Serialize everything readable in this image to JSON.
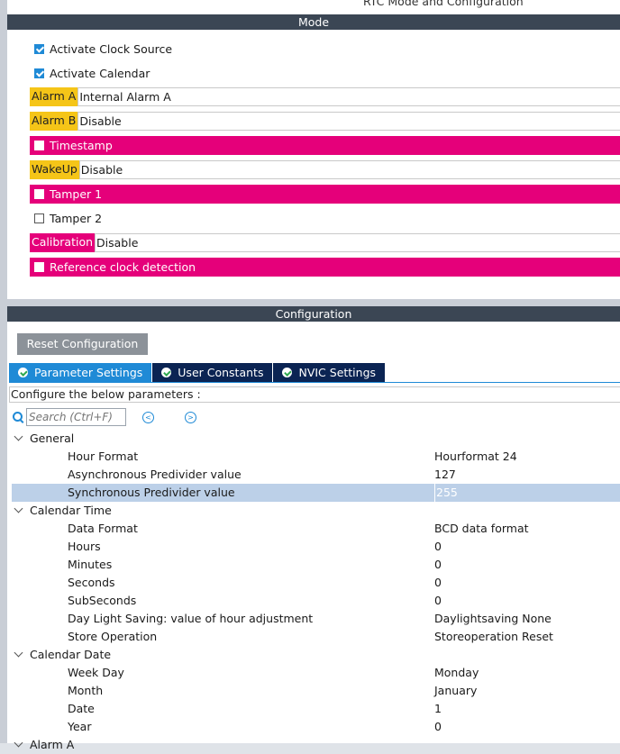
{
  "window": {
    "title": "RTC Mode and Configuration"
  },
  "mode": {
    "header": "Mode",
    "activate_clock_source": {
      "label": "Activate Clock Source",
      "checked": true
    },
    "activate_calendar": {
      "label": "Activate Calendar",
      "checked": true
    },
    "alarm_a": {
      "label": "Alarm A",
      "value": "Internal Alarm A"
    },
    "alarm_b": {
      "label": "Alarm B",
      "value": "Disable"
    },
    "timestamp": {
      "label": "Timestamp",
      "checked": false
    },
    "wakeup": {
      "label": "WakeUp",
      "value": "Disable"
    },
    "tamper1": {
      "label": "Tamper 1",
      "checked": false
    },
    "tamper2": {
      "label": "Tamper 2",
      "checked": false
    },
    "calibration": {
      "label": "Calibration",
      "value": "Disable"
    },
    "reference_clock": {
      "label": "Reference clock detection",
      "checked": false
    }
  },
  "config": {
    "header": "Configuration",
    "reset_label": "Reset Configuration",
    "tabs": [
      {
        "label": "Parameter Settings",
        "active": true
      },
      {
        "label": "User Constants",
        "active": false
      },
      {
        "label": "NVIC Settings",
        "active": false
      }
    ],
    "hint": "Configure the below parameters :",
    "search": {
      "placeholder": "Search (Ctrl+F)"
    },
    "groups": [
      {
        "label": "General",
        "params": [
          {
            "name": "Hour Format",
            "value": "Hourformat 24"
          },
          {
            "name": "Asynchronous Predivider value",
            "value": "127"
          },
          {
            "name": "Synchronous Predivider value",
            "value": "255",
            "selected": true
          }
        ]
      },
      {
        "label": "Calendar Time",
        "params": [
          {
            "name": "Data Format",
            "value": "BCD data format"
          },
          {
            "name": "Hours",
            "value": "0"
          },
          {
            "name": "Minutes",
            "value": "0"
          },
          {
            "name": "Seconds",
            "value": "0"
          },
          {
            "name": "SubSeconds",
            "value": "0"
          },
          {
            "name": "Day Light Saving: value of hour adjustment",
            "value": "Daylightsaving None"
          },
          {
            "name": "Store Operation",
            "value": "Storeoperation Reset"
          }
        ]
      },
      {
        "label": "Calendar Date",
        "params": [
          {
            "name": "Week Day",
            "value": "Monday"
          },
          {
            "name": "Month",
            "value": "January"
          },
          {
            "name": "Date",
            "value": "1"
          },
          {
            "name": "Year",
            "value": "0"
          }
        ]
      },
      {
        "label": "Alarm A",
        "params": []
      }
    ]
  },
  "colors": {
    "accent_blue": "#1f8ad6",
    "header_dark": "#3b4654",
    "tab_dark": "#0b2453",
    "magenta": "#e5007a",
    "yellow": "#f5c518",
    "selected_row": "#bcd0e8"
  }
}
